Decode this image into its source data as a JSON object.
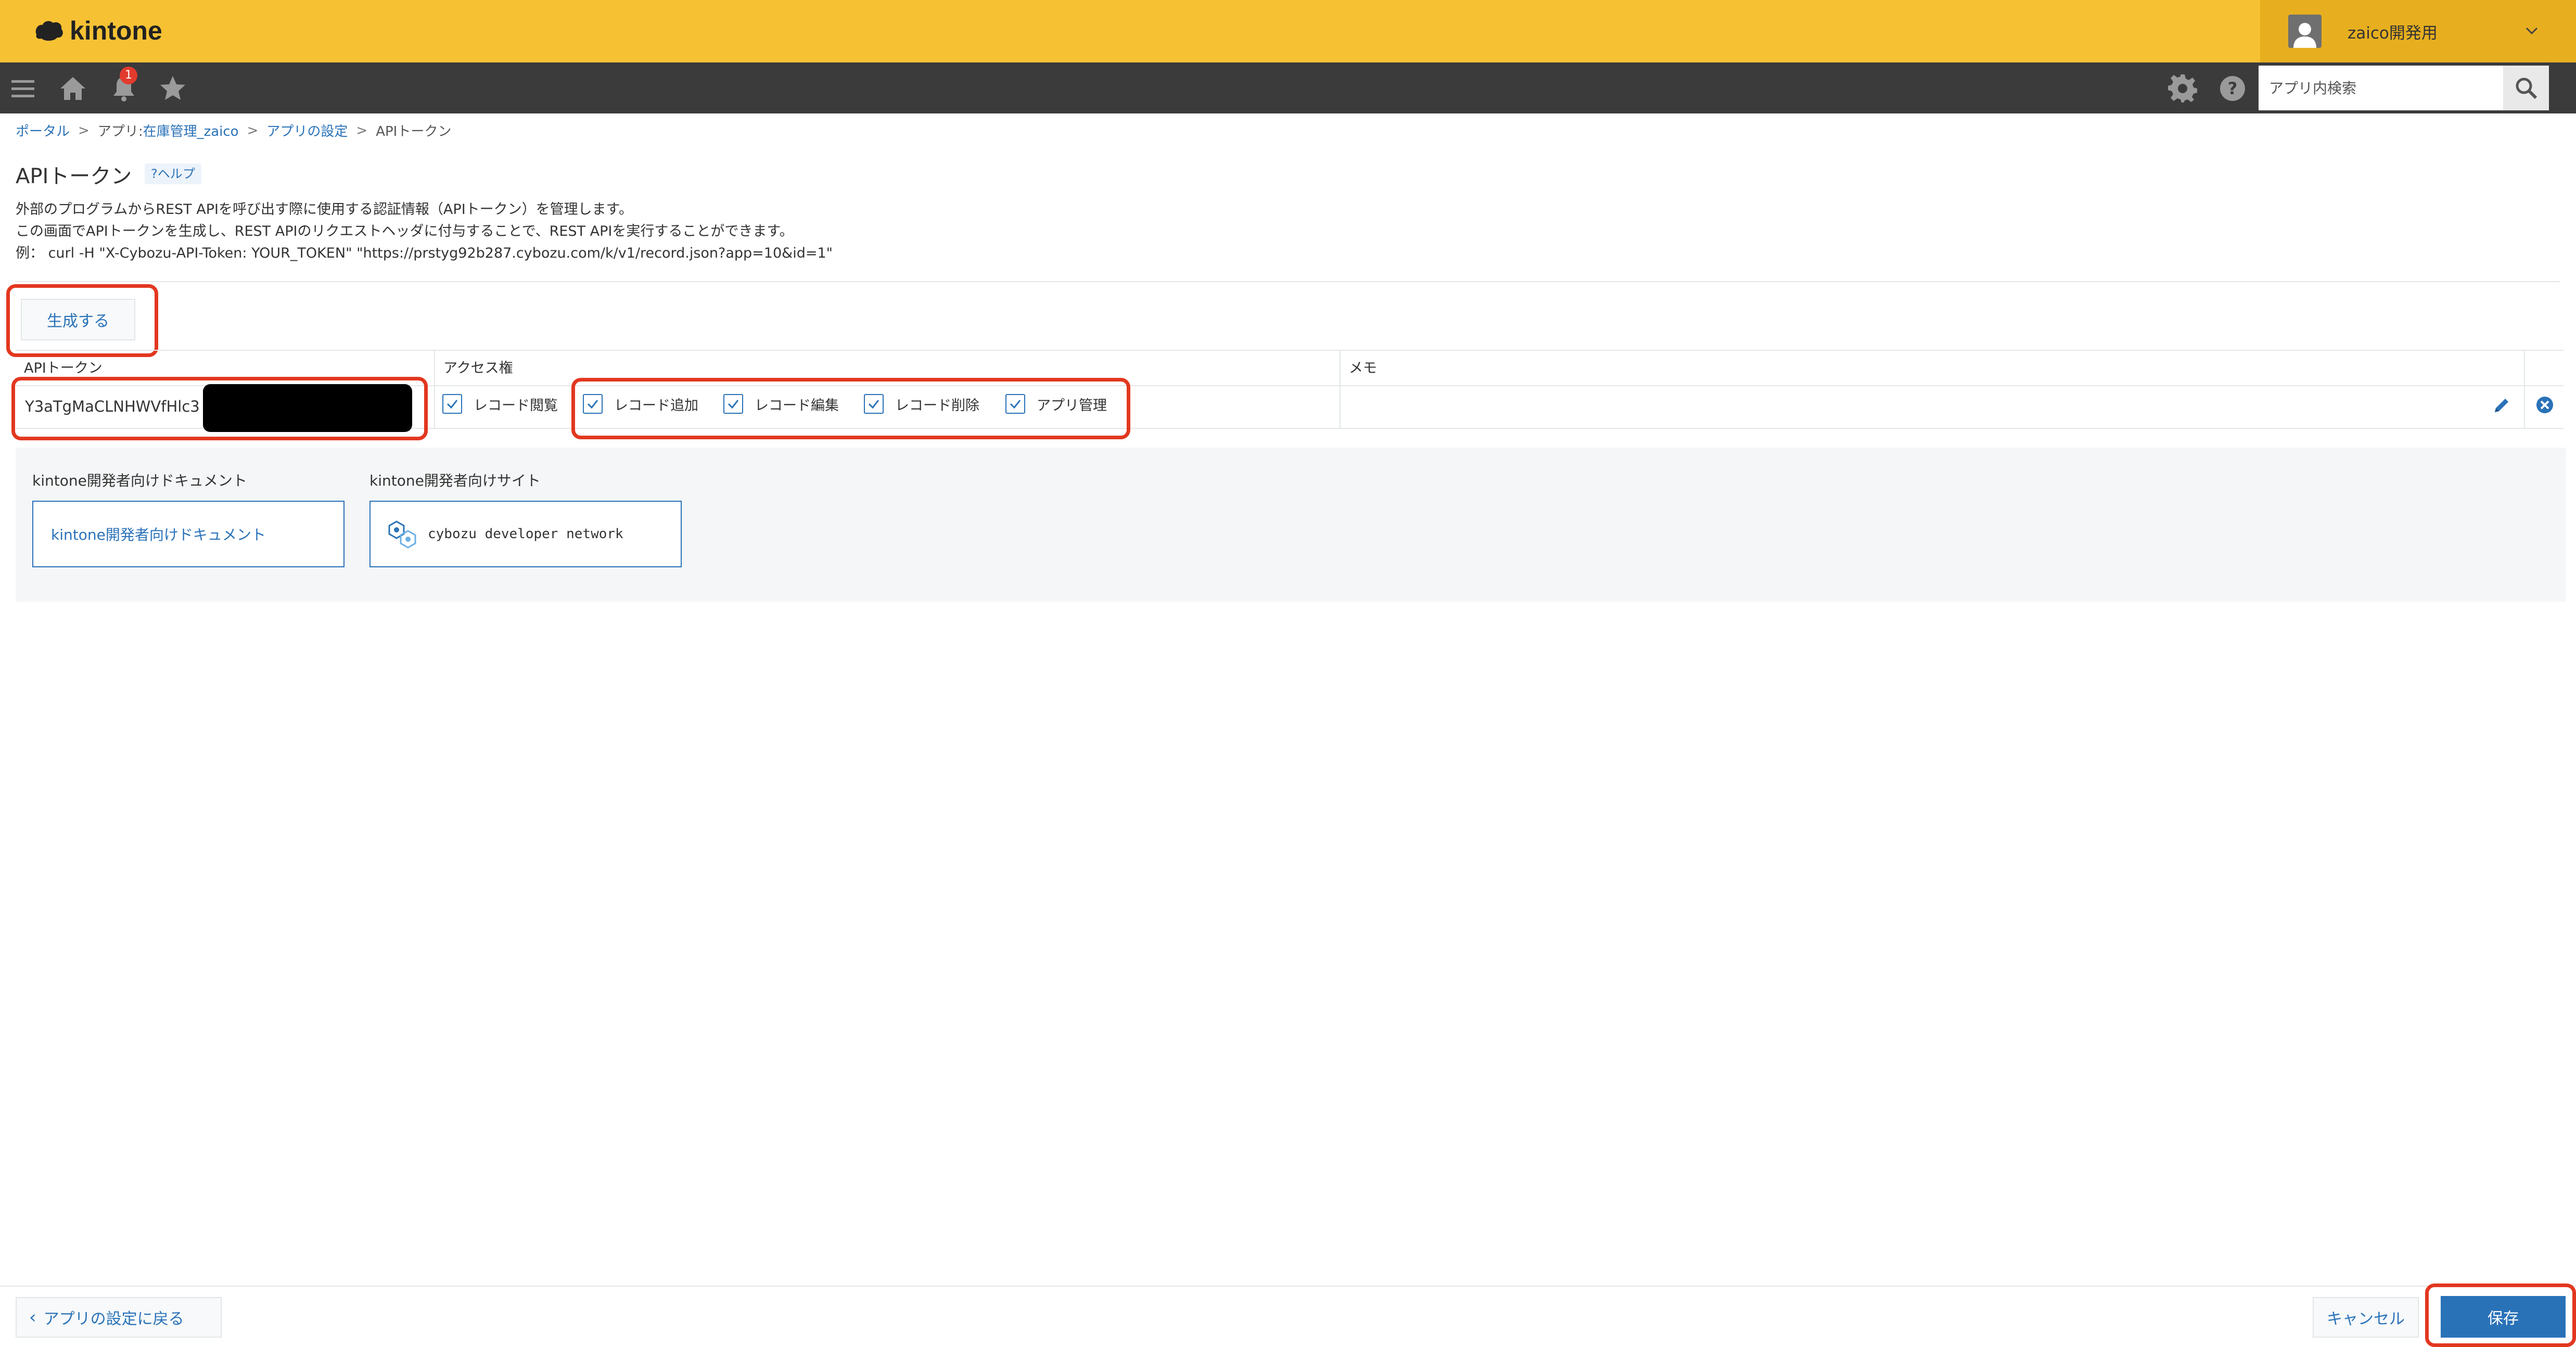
{
  "app": {
    "logo_text": "kintone"
  },
  "header": {
    "user_name": "zaico開発用",
    "notification_count": "1"
  },
  "search": {
    "placeholder": "アプリ内検索"
  },
  "breadcrumb": {
    "portal": "ポータル",
    "app_prefix": "アプリ: ",
    "app_name": "在庫管理_zaico",
    "settings": "アプリの設定",
    "current": "APIトークン",
    "separator": ">"
  },
  "page": {
    "title": "APIトークン",
    "help_label": "?ヘルプ",
    "description": [
      "外部のプログラムからREST APIを呼び出す際に使用する認証情報（APIトークン）を管理します。",
      "この画面でAPIトークンを生成し、REST APIのリクエストヘッダに付与することで、REST APIを実行することができます。",
      "例： curl -H \"X-Cybozu-API-Token: YOUR_TOKEN\" \"https://prstyg92b287.cybozu.com/k/v1/record.json?app=10&id=1\""
    ]
  },
  "actions": {
    "generate_label": "生成する"
  },
  "table": {
    "headers": {
      "token": "APIトークン",
      "access": "アクセス権",
      "memo": "メモ"
    },
    "rows": [
      {
        "token": "Y3aTgMaCLNHWVfHlc3",
        "permissions": [
          {
            "label": "レコード閲覧",
            "checked": true
          },
          {
            "label": "レコード追加",
            "checked": true
          },
          {
            "label": "レコード編集",
            "checked": true
          },
          {
            "label": "レコード削除",
            "checked": true
          },
          {
            "label": "アプリ管理",
            "checked": true
          }
        ],
        "memo": ""
      }
    ]
  },
  "developer": {
    "docs_heading": "kintone開発者向けドキュメント",
    "docs_link": "kintone開発者向けドキュメント",
    "site_heading": "kintone開発者向けサイト",
    "site_link": "cybozu developer network"
  },
  "footer": {
    "back_label": "アプリの設定に戻る",
    "cancel_label": "キャンセル",
    "save_label": "保存"
  },
  "colors": {
    "header_bg": "#f6c234",
    "nav_bg": "#3b3b3b",
    "accent_blue": "#2a72b8",
    "highlight_red": "#e2371f"
  },
  "icons": [
    "kintone-logo-icon",
    "user-avatar-icon",
    "chevron-down-icon",
    "menu-icon",
    "home-icon",
    "bell-icon",
    "star-icon",
    "gear-icon",
    "help-icon",
    "search-icon",
    "checkbox-checked-icon",
    "pencil-icon",
    "remove-circle-icon",
    "cybozu-developer-network-icon",
    "chevron-left-icon"
  ]
}
